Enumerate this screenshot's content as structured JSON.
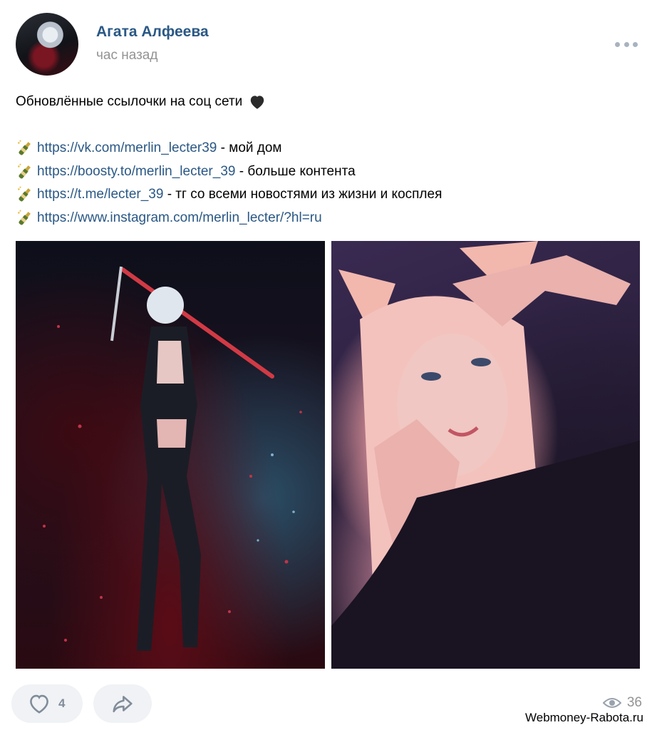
{
  "post": {
    "author": "Агата Алфеева",
    "time": "час назад",
    "text": {
      "intro": "Обновлённые ссылочки на соц сети",
      "links": [
        {
          "url": "https://vk.com/merlin_lecter39",
          "suffix": " - мой дом"
        },
        {
          "url": "https://boosty.to/merlin_lecter_39",
          "suffix": " - больше контента"
        },
        {
          "url": "https://t.me/lecter_39",
          "suffix": " - тг со всеми новостями из жизни и косплея"
        },
        {
          "url": "https://www.instagram.com/merlin_lecter/?hl=ru",
          "suffix": ""
        }
      ]
    },
    "likes": "4",
    "views": "36"
  },
  "icons": {
    "more": "more-dots-icon",
    "heart": "black-heart-emoji",
    "bottle": "champagne-bottle-emoji",
    "like": "heart-outline-icon",
    "share": "share-arrow-icon",
    "views": "eye-icon"
  },
  "colors": {
    "link": "#2a5885",
    "muted": "#939393",
    "button_bg": "#f0f2f5"
  },
  "watermark": "Webmoney-Rabota.ru"
}
